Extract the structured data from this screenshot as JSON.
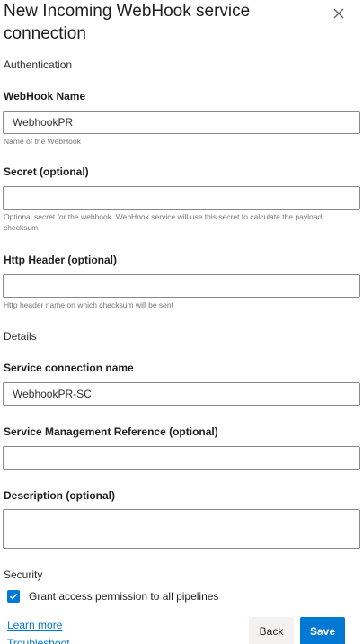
{
  "panel": {
    "title": "New Incoming WebHook service connection",
    "close_icon": "close-icon"
  },
  "authentication": {
    "section_label": "Authentication",
    "webhook_name": {
      "label": "WebHook Name",
      "value": "WebhookPR",
      "help": "Name of the WebHook"
    },
    "secret": {
      "label": "Secret (optional)",
      "value": "",
      "help": "Optional secret for the webhook. WebHook service will use this secret to calculate the payload checksum"
    },
    "http_header": {
      "label": "Http Header (optional)",
      "value": "",
      "help": "Http header name on which checksum will be sent"
    }
  },
  "details": {
    "section_label": "Details",
    "service_connection_name": {
      "label": "Service connection name",
      "value": "WebhookPR-SC"
    },
    "service_management_reference": {
      "label": "Service Management Reference (optional)",
      "value": ""
    },
    "description": {
      "label": "Description (optional)",
      "value": ""
    }
  },
  "security": {
    "section_label": "Security",
    "grant_access_label": "Grant access permission to all pipelines",
    "grant_access_checked": true
  },
  "footer": {
    "learn_more": "Learn more",
    "troubleshoot": "Troubleshoot",
    "back_label": "Back",
    "save_label": "Save"
  },
  "colors": {
    "accent": "#0078d4",
    "highlight": "#a6d85a"
  }
}
